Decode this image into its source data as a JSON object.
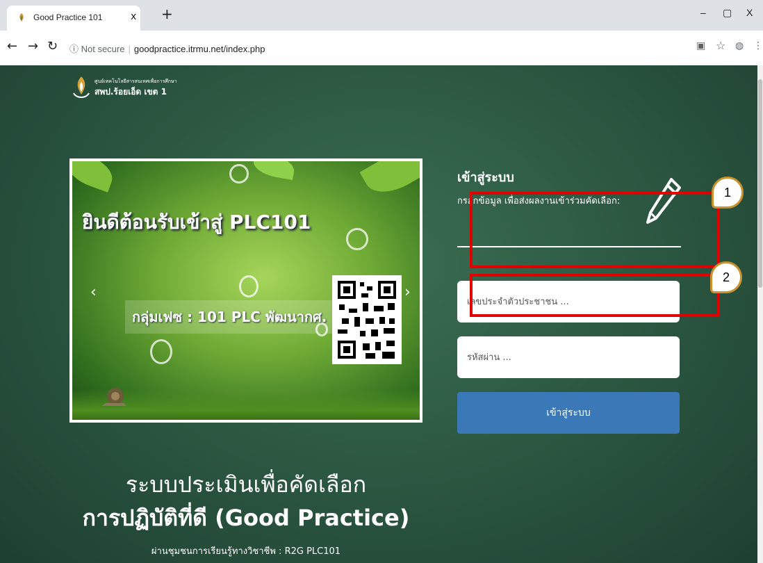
{
  "browser": {
    "tab_title": "Good Practice 101",
    "tab_close": "x",
    "new_tab": "+",
    "minimize": "–",
    "maximize": "▢",
    "close": "X",
    "security_label": "ⓘ Not secure",
    "url": "goodpractice.itrmu.net/index.php"
  },
  "header": {
    "logo_small": "ศูนย์เทคโนโลยีสารสนเทศเพื่อการศึกษา",
    "logo_text": "สพป.ร้อยเอ็ด เขต 1"
  },
  "banner": {
    "welcome": "ยินดีต้อนรับเข้าสู่ PLC101",
    "group": "กลุ่มเฟซ : 101 PLC พัฒนากศ."
  },
  "main": {
    "title": "ระบบประเมินเพื่อคัดเลือก",
    "subtitle": "การปฏิบัติที่ดี (Good Practice)",
    "footer": "ผ่านชุมชนการเรียนรู้ทางวิชาชีพ : R2G PLC101"
  },
  "login": {
    "title": "เข้าสู่ระบบ",
    "description": "กรอกข้อมูล เพื่อส่งผลงานเข้าร่วมคัดเลือก:",
    "id_placeholder": "เลขประจำตัวประชาชน ...",
    "password_placeholder": "รหัสผ่าน ...",
    "submit_label": "เข้าสู่ระบบ"
  },
  "annotations": {
    "callout_1": "1",
    "callout_2": "2",
    "box_color": "#e00000"
  }
}
